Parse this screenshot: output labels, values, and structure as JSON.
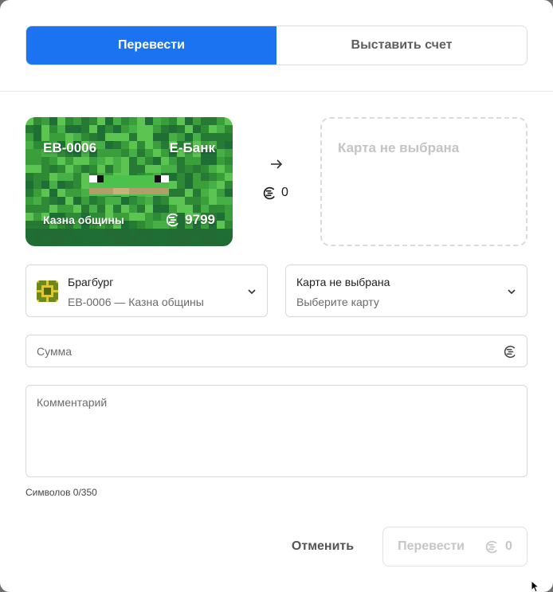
{
  "tabs": [
    {
      "label": "Перевести",
      "active": true
    },
    {
      "label": "Выставить счет",
      "active": false
    }
  ],
  "source_card": {
    "id": "EB-0006",
    "bank": "Е-Банк",
    "name": "Казна общины",
    "balance": "9799",
    "colors": {
      "base": "#3a9e3a",
      "dark": "#1e6e36",
      "light": "#5cc450"
    }
  },
  "transfer": {
    "arrow_icon": "arrow-right-icon",
    "amount": "0"
  },
  "target_card": {
    "placeholder": "Карта не выбрана"
  },
  "from_select": {
    "title": "Брагбург",
    "subtitle": "EB-0006 — Казна общины"
  },
  "to_select": {
    "title": "Карта не выбрана",
    "subtitle": "Выберите карту"
  },
  "sum_field": {
    "placeholder": "Сумма",
    "value": ""
  },
  "comment_field": {
    "placeholder": "Комментарий",
    "value": "",
    "counter": "Символов 0/350"
  },
  "footer": {
    "cancel_label": "Отменить",
    "submit_label": "Перевести",
    "submit_amount": "0"
  },
  "colors": {
    "accent": "#1c73f1",
    "border": "#d9d9d9",
    "muted": "#c6c6c6"
  }
}
